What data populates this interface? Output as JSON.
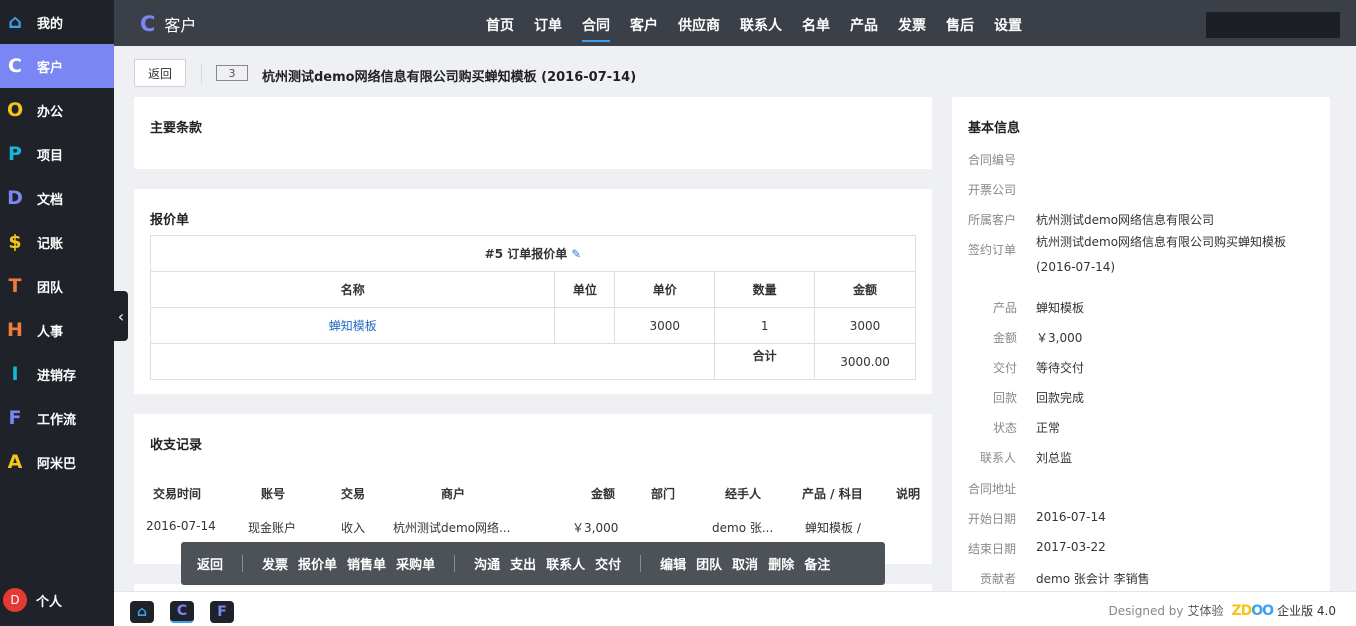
{
  "sidebar": {
    "items": [
      {
        "icon": "home-icon",
        "glyph": "⌂",
        "label": "我的",
        "color": "#3ca0f0"
      },
      {
        "icon": "customer-icon",
        "glyph": "C",
        "label": "客户",
        "color": "#ffffff"
      },
      {
        "icon": "office-icon",
        "glyph": "O",
        "label": "办公",
        "color": "#f5c518"
      },
      {
        "icon": "project-icon",
        "glyph": "P",
        "label": "项目",
        "color": "#16b5d9"
      },
      {
        "icon": "doc-icon",
        "glyph": "D",
        "label": "文档",
        "color": "#7b86f5"
      },
      {
        "icon": "cash-icon",
        "glyph": "$",
        "label": "记账",
        "color": "#f5c518"
      },
      {
        "icon": "team-icon",
        "glyph": "T",
        "label": "团队",
        "color": "#f07c3c"
      },
      {
        "icon": "hr-icon",
        "glyph": "H",
        "label": "人事",
        "color": "#f07c3c"
      },
      {
        "icon": "psi-icon",
        "glyph": "I",
        "label": "进销存",
        "color": "#16b5d9"
      },
      {
        "icon": "flow-icon",
        "glyph": "F",
        "label": "工作流",
        "color": "#7b86f5"
      },
      {
        "icon": "amoeba-icon",
        "glyph": "A",
        "label": "阿米巴",
        "color": "#f5c518"
      }
    ],
    "user_initial": "D",
    "user_label": "个人"
  },
  "topbar": {
    "app_glyph": "C",
    "app_title": "客户",
    "nav": [
      "首页",
      "订单",
      "合同",
      "客户",
      "供应商",
      "联系人",
      "名单",
      "产品",
      "发票",
      "售后",
      "设置"
    ],
    "active_nav": "合同"
  },
  "header": {
    "back_label": "返回",
    "id": "3",
    "title": "杭州测试demo网络信息有限公司购买蝉知模板 (2016-07-14)"
  },
  "main_terms": {
    "title": "主要条款"
  },
  "quote": {
    "title": "报价单",
    "table_title": "#5 订单报价单",
    "columns": [
      "名称",
      "单位",
      "单价",
      "数量",
      "金额"
    ],
    "rows": [
      [
        "蝉知模板",
        "",
        "3000",
        "1",
        "3000"
      ]
    ],
    "total_label": "合计",
    "total_value": "3000.00"
  },
  "transactions": {
    "title": "收支记录",
    "columns": [
      "交易时间",
      "账号",
      "交易",
      "商户",
      "金额",
      "部门",
      "经手人",
      "产品 / 科目",
      "说明"
    ],
    "rows": [
      [
        "2016-07-14",
        "现金账户",
        "收入",
        "杭州测试demo网络...",
        "￥3,000",
        "",
        "demo 张...",
        "蝉知模板 /",
        ""
      ]
    ]
  },
  "action_bar": {
    "group1": [
      "返回"
    ],
    "group2": [
      "发票",
      "报价单",
      "销售单",
      "采购单"
    ],
    "group3": [
      "沟通",
      "支出",
      "联系人",
      "交付"
    ],
    "group4": [
      "编辑",
      "团队",
      "取消",
      "删除",
      "备注"
    ]
  },
  "basic_info": {
    "title": "基本信息",
    "fields": [
      {
        "label": "合同编号",
        "value": ""
      },
      {
        "label": "开票公司",
        "value": ""
      },
      {
        "label": "所属客户",
        "value": "杭州测试demo网络信息有限公司"
      },
      {
        "label": "签约订单",
        "value": "杭州测试demo网络信息有限公司购买蝉知模板"
      },
      {
        "label": "产品",
        "value": "蝉知模板"
      },
      {
        "label": "金额",
        "value": "￥3,000"
      },
      {
        "label": "交付",
        "value": "等待交付"
      },
      {
        "label": "回款",
        "value": "回款完成"
      },
      {
        "label": "状态",
        "value": "正常"
      },
      {
        "label": "联系人",
        "value": "刘总监"
      },
      {
        "label": "合同地址",
        "value": ""
      },
      {
        "label": "开始日期",
        "value": "2016-07-14"
      },
      {
        "label": "结束日期",
        "value": "2017-03-22"
      },
      {
        "label": "贡献者",
        "value": "demo 张会计 李销售"
      }
    ],
    "order_date_line": "(2016-07-14)"
  },
  "footer": {
    "apps": [
      {
        "icon": "home-icon",
        "glyph": "⌂",
        "color": "#3ca0f0"
      },
      {
        "icon": "customer-icon",
        "glyph": "C",
        "color": "#7b86f5"
      },
      {
        "icon": "flow-icon",
        "glyph": "F",
        "color": "#7b86f5"
      }
    ],
    "designed_by": "Designed by",
    "designer": "艾体验",
    "logo": "ZDOO",
    "edition": "企业版 4.0"
  },
  "colors": {
    "accent": "#7b86f5",
    "link": "#1e6bbf",
    "sidebar_bg": "#1f2329",
    "topbar_bg": "#3b4048"
  }
}
